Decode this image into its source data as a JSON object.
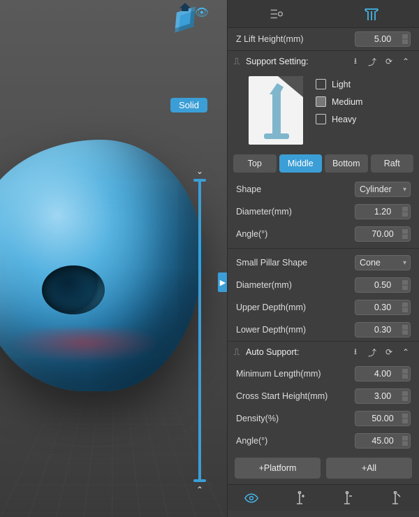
{
  "viewport": {
    "shading_label": "Solid"
  },
  "panel": {
    "z_lift": {
      "label": "Z Lift Height(mm)",
      "value": "5.00"
    },
    "support_setting": {
      "title": "Support Setting:",
      "presets": {
        "light": "Light",
        "medium": "Medium",
        "heavy": "Heavy"
      },
      "tabs": {
        "top": "Top",
        "middle": "Middle",
        "bottom": "Bottom",
        "raft": "Raft",
        "active": "middle"
      },
      "middle": {
        "shape": {
          "label": "Shape",
          "value": "Cylinder"
        },
        "diameter": {
          "label": "Diameter(mm)",
          "value": "1.20"
        },
        "angle": {
          "label": "Angle(°)",
          "value": "70.00"
        },
        "small_pillar_shape": {
          "label": "Small Pillar Shape",
          "value": "Cone"
        },
        "sp_diameter": {
          "label": "Diameter(mm)",
          "value": "0.50"
        },
        "upper_depth": {
          "label": "Upper Depth(mm)",
          "value": "0.30"
        },
        "lower_depth": {
          "label": "Lower Depth(mm)",
          "value": "0.30"
        }
      }
    },
    "auto_support": {
      "title": "Auto Support:",
      "min_length": {
        "label": "Minimum Length(mm)",
        "value": "4.00"
      },
      "cross_start": {
        "label": "Cross Start Height(mm)",
        "value": "3.00"
      },
      "density": {
        "label": "Density(%)",
        "value": "50.00"
      },
      "angle": {
        "label": "Angle(°)",
        "value": "45.00"
      },
      "btn_platform": "+Platform",
      "btn_all": "+All"
    }
  }
}
